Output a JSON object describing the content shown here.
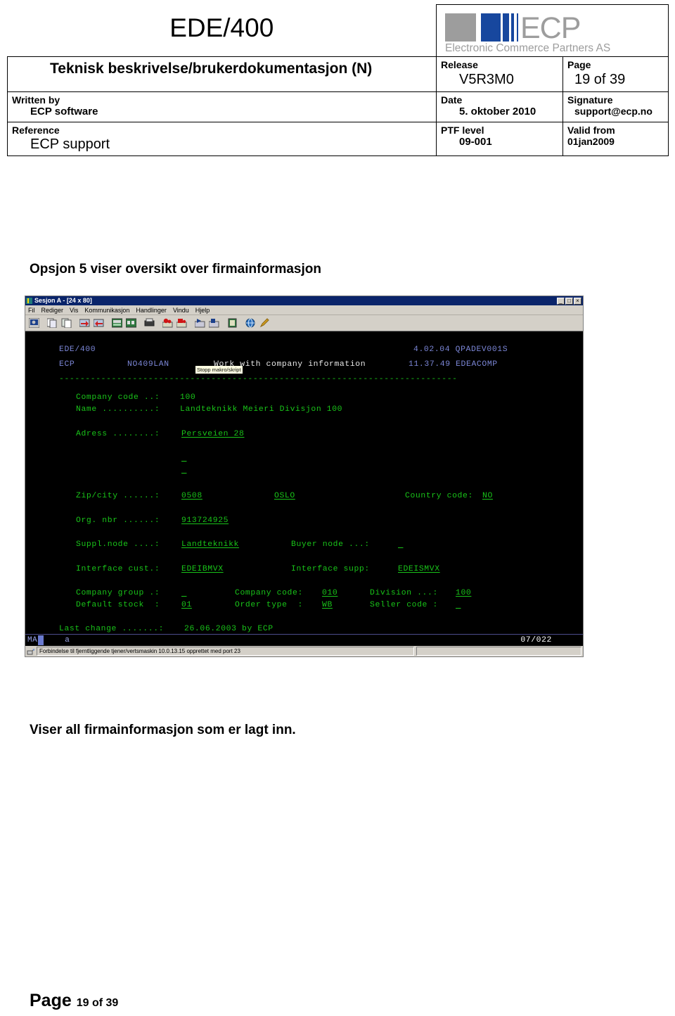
{
  "doc_header": {
    "title": "EDE/400",
    "subtitle": "Teknisk beskrivelse/brukerdokumentasjon (N)",
    "logo": {
      "brand": "ECP",
      "tagline": "Electronic Commerce Partners AS",
      "gray": "#9d9d9d",
      "blue": "#17479e"
    },
    "release_label": "Release",
    "release_value": "V5R3M0",
    "page_label": "Page",
    "page_value": "19 of 39",
    "written_by_label": "Written by",
    "written_by_value": "ECP software",
    "date_label": "Date",
    "date_value": "5. oktober 2010",
    "signature_label": "Signature",
    "signature_value": "support@ecp.no",
    "reference_label": "Reference",
    "reference_value": "ECP support",
    "ptf_label": "PTF level",
    "ptf_value": "09-001",
    "valid_label": "Valid from",
    "valid_value": "01jan2009"
  },
  "body": {
    "heading": "Opsjon 5 viser oversikt over firmainformasjon",
    "caption": "Viser all firmainformasjon som er lagt inn.",
    "footer_page_label": "Page",
    "footer_page_value": "19 of 39"
  },
  "terminal": {
    "window_title": "Sesjon A - [24 x 80]",
    "window_buttons": {
      "minimize": "_",
      "restore": "□",
      "close": "×"
    },
    "menu": [
      "Fil",
      "Rediger",
      "Vis",
      "Kommunikasjon",
      "Handlinger",
      "Vindu",
      "Hjelp"
    ],
    "tooltip": "Stopp makro/skript",
    "toolbar_icons": [
      "display-session-icon",
      "copy-icon",
      "paste-icon",
      "send-file-icon",
      "receive-file-icon",
      "keyboard-map-icon",
      "display-setup-icon",
      "print-screen-icon",
      "record-macro-icon",
      "stop-macro-icon",
      "play-macro-icon",
      "play-macro-alt-icon",
      "index-icon",
      "internet-icon",
      "edit-icon"
    ],
    "screen": {
      "line1_left": "EDE/400",
      "line1_right": "4.02.04 QPADEV001S",
      "line2_sys": "ECP",
      "line2_lan": "NO409LAN",
      "line2_title": "Work with company information",
      "line2_right": "11.37.49 EDEACOMP",
      "separator": "----------------------------------------------------------------------------",
      "fields": {
        "company_code_label": "Company code ..:",
        "company_code_value": "100",
        "name_label": "Name ..........:",
        "name_value": "Landteknikk Meieri Divisjon 100",
        "adress_label": "Adress ........:",
        "adress_value": "Persveien 28",
        "adress_line2": "",
        "adress_line3": "",
        "zipcity_label": "Zip/city ......:",
        "zip_value": "0508",
        "city_value": "OSLO",
        "country_label": "Country code:",
        "country_value": "NO",
        "orgnbr_label": "Org. nbr ......:",
        "orgnbr_value": "913724925",
        "supplnode_label": "Suppl.node ....:",
        "supplnode_value": "Landteknikk",
        "buyernode_label": "Buyer node ...:",
        "buyernode_value": "",
        "ifcust_label": "Interface cust.:",
        "ifcust_value": "EDEIBMVX",
        "ifsupp_label": "Interface supp:",
        "ifsupp_value": "EDEISMVX",
        "compgroup_label": "Company group .:",
        "compgroup_value": "",
        "compcode_label": "Company code:",
        "compcode_value": "010",
        "division_label": "Division ...:",
        "division_value": "100",
        "defstock_label": "Default stock  :",
        "defstock_value": "01",
        "ordertype_label": "Order type  :",
        "ordertype_value": "WB",
        "sellercode_label": "Seller code :",
        "sellercode_value": "",
        "lastchange_label": "Last change .......:",
        "lastchange_value": "26.06.2003 by ECP"
      }
    },
    "oia": {
      "ma_indicator": "MA",
      "input_indicator": "a",
      "cursor_position": "07/022"
    },
    "status_bar": {
      "connection_text": "Forbindelse til fjerntliggende tjener/vertsmaskin 10.0.13.15 opprettet med port 23"
    }
  },
  "colors": {
    "terminal_green": "#19c419",
    "terminal_blue": "#7b86d6",
    "terminal_white": "#e8e8e8",
    "title_bar": "#0a246a",
    "window_chrome": "#d4d0c8"
  }
}
